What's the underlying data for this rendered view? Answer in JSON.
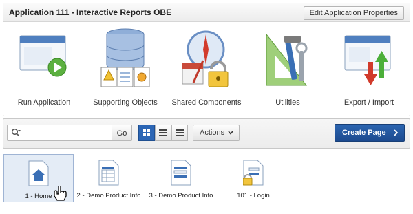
{
  "panel": {
    "title": "Application 111 - Interactive Reports OBE",
    "edit_button": "Edit Application Properties"
  },
  "tiles": [
    {
      "label": "Run Application",
      "icon": "run-application-icon"
    },
    {
      "label": "Supporting Objects",
      "icon": "supporting-objects-icon"
    },
    {
      "label": "Shared Components",
      "icon": "shared-components-icon"
    },
    {
      "label": "Utilities",
      "icon": "utilities-icon"
    },
    {
      "label": "Export / Import",
      "icon": "export-import-icon"
    }
  ],
  "toolbar": {
    "search_value": "",
    "go_label": "Go",
    "actions_label": "Actions",
    "create_page_label": "Create Page"
  },
  "pages": [
    {
      "label": "1 - Home",
      "selected": true,
      "icon": "home-page-icon"
    },
    {
      "label": "2 - Demo Product Info",
      "selected": false,
      "icon": "report-page-icon"
    },
    {
      "label": "3 - Demo Product Info",
      "selected": false,
      "icon": "form-page-icon"
    },
    {
      "label": "101 - Login",
      "selected": false,
      "icon": "login-page-icon"
    }
  ],
  "colors": {
    "accent": "#2c66b5",
    "primary_button": "#1c4a8f"
  }
}
